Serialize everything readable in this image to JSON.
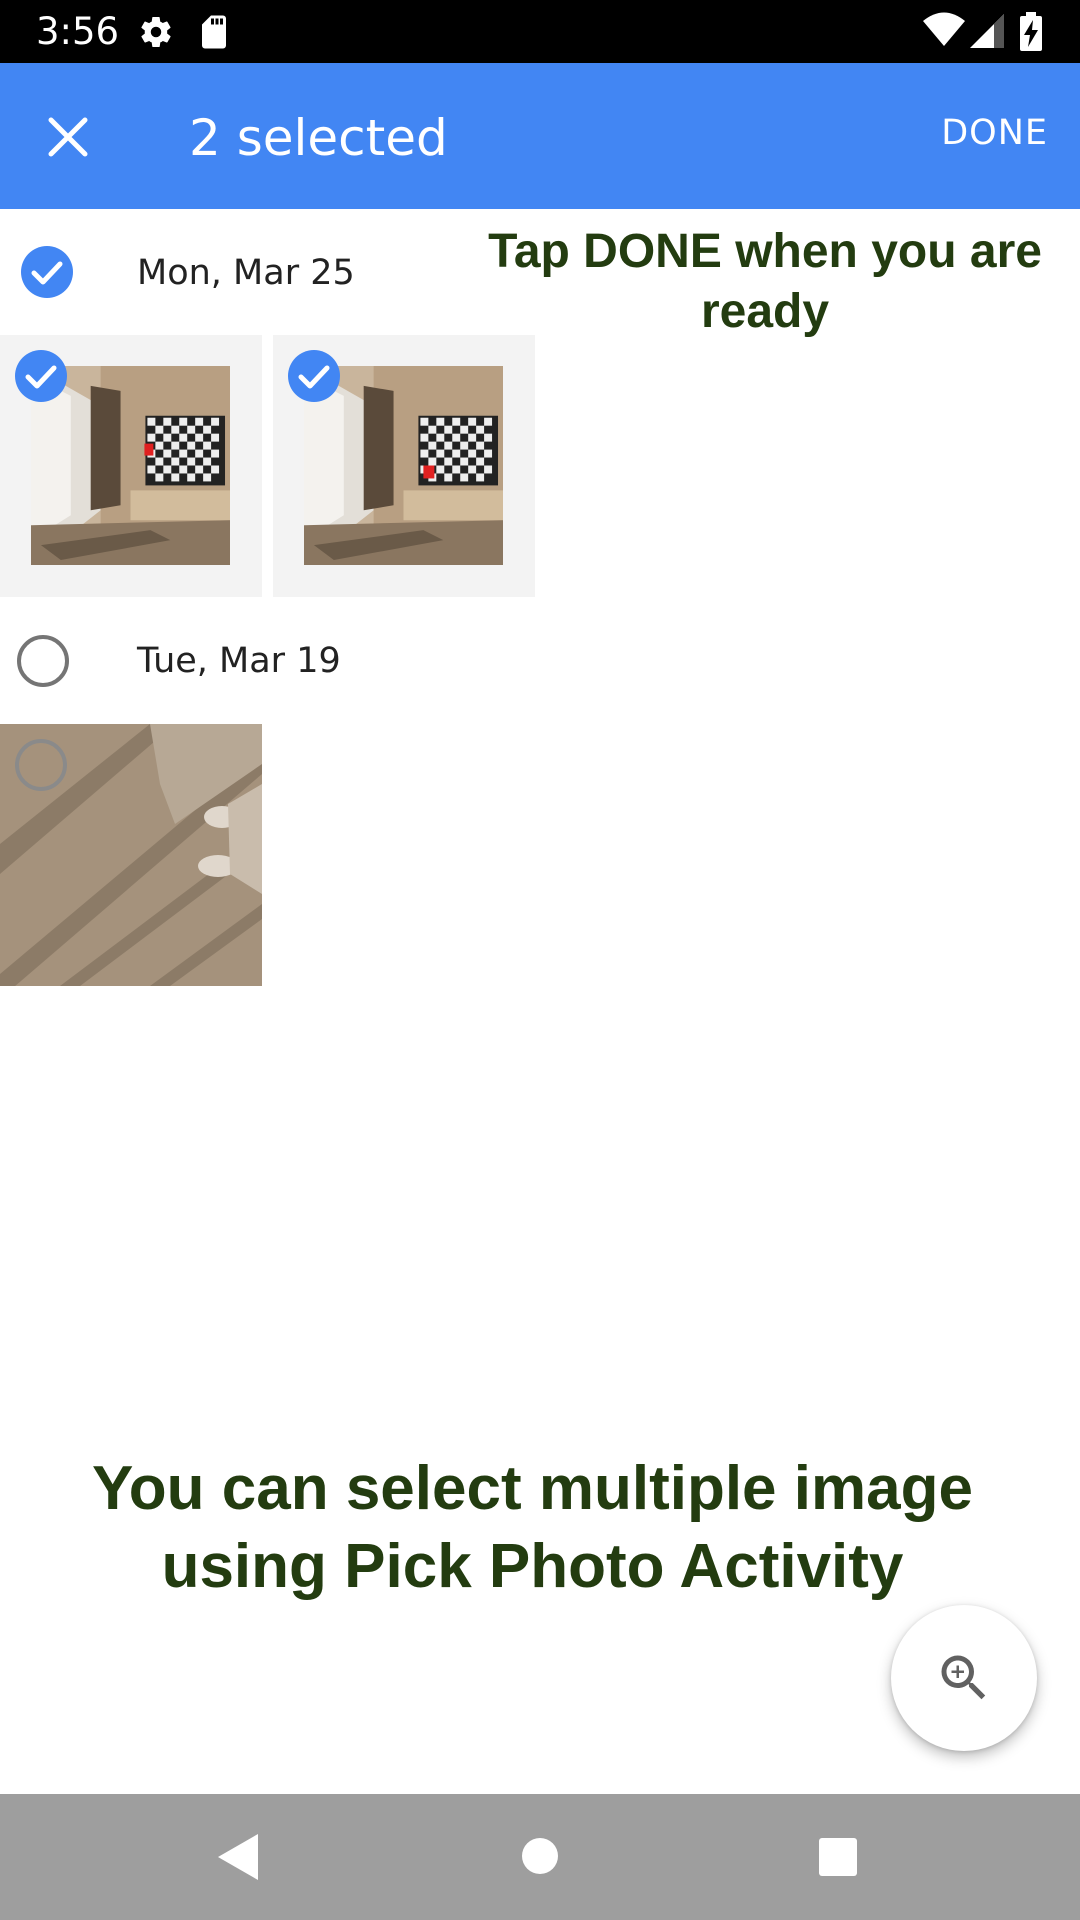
{
  "status_bar": {
    "time": "3:56",
    "icons": [
      "gear-icon",
      "sd-card-icon",
      "wifi-icon",
      "cell-signal-icon",
      "battery-charging-icon"
    ]
  },
  "app_bar": {
    "close_icon": "close-icon",
    "title": "2 selected",
    "done_label": "DONE",
    "color": "#4286f3"
  },
  "groups": [
    {
      "date": "Mon, Mar 25",
      "selected": true,
      "photos": [
        {
          "selected": true
        },
        {
          "selected": true
        }
      ]
    },
    {
      "date": "Tue, Mar 19",
      "selected": false,
      "photos": [
        {
          "selected": false
        }
      ]
    }
  ],
  "annotations": {
    "top_line1": "Tap DONE when you are",
    "top_line2": "ready",
    "bottom_line1": "You can select multiple image",
    "bottom_line2": "using Pick Photo Activity",
    "color": "#233c10"
  },
  "fab": {
    "icon": "zoom-in-icon"
  },
  "nav_bar": {
    "icons": [
      "back-icon",
      "home-icon",
      "recents-icon"
    ]
  },
  "colors": {
    "accent": "#4286f3",
    "check_unselected": "#757575"
  }
}
